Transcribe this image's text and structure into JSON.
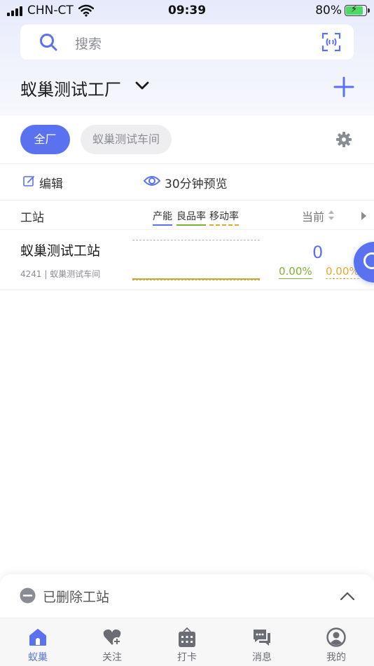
{
  "status_bar": {
    "carrier": "CHN-CT",
    "time": "09:39",
    "battery_percent": "80%"
  },
  "search": {
    "placeholder": "搜索"
  },
  "header": {
    "factory_name": "蚁巢测试工厂"
  },
  "filters": {
    "all_label": "全厂",
    "workshop_label": "蚁巢测试车间"
  },
  "actions": {
    "edit_label": "编辑",
    "preview_label": "30分钟预览"
  },
  "table": {
    "col_station": "工站",
    "col_capacity": "产能",
    "col_yield": "良品率",
    "col_move": "移动率",
    "col_current": "当前",
    "rows": [
      {
        "name": "蚁巢测试工站",
        "sub": "4241 | 蚁巢测试车间",
        "current": "0",
        "yield_rate": "0.00%",
        "move_rate": "0.00%"
      }
    ]
  },
  "deleted_panel": {
    "label": "已删除工站"
  },
  "tabbar": {
    "items": [
      {
        "label": "蚁巢",
        "icon": "home-icon",
        "active": true
      },
      {
        "label": "关注",
        "icon": "heart-plus-icon",
        "active": false
      },
      {
        "label": "打卡",
        "icon": "calendar-icon",
        "active": false
      },
      {
        "label": "消息",
        "icon": "message-icon",
        "active": false
      },
      {
        "label": "我的",
        "icon": "profile-icon",
        "active": false
      }
    ]
  },
  "colors": {
    "accent": "#5a72f0",
    "yield": "#7ab32e",
    "move": "#e5a92a"
  }
}
